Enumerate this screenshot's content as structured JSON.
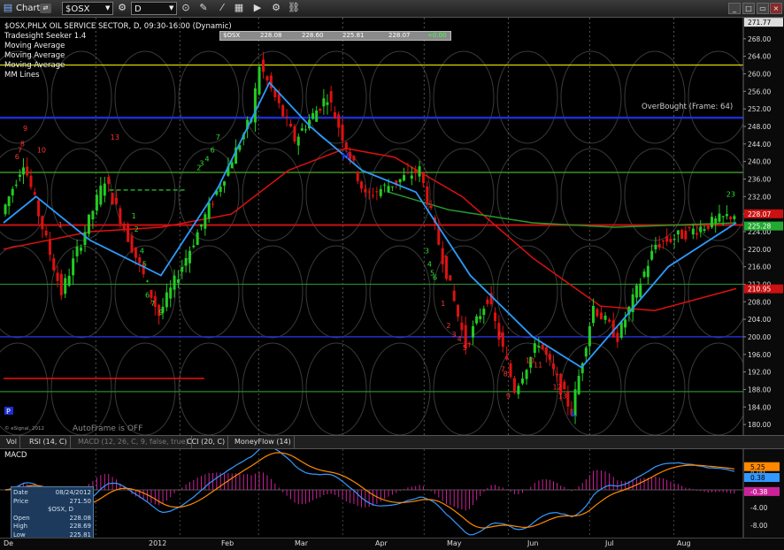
{
  "toolbar": {
    "app_label": "Chart",
    "symbol": "$OSX",
    "interval": "D",
    "buttons": [
      "zoom-icon",
      "draw-icon",
      "line-icon",
      "cursor-icon",
      "grid-icon",
      "play-icon",
      "settings-icon",
      "link-icon"
    ]
  },
  "legend": {
    "title": "$OSX,PHLX OIL SERVICE SECTOR, D, 09:30-16:00 (Dynamic)",
    "studies": [
      "Tradesight Seeker 1.4",
      "Moving Average",
      "Moving Average",
      "Moving Average",
      "MM Lines"
    ]
  },
  "quote_bar": {
    "symbol": "$OSX",
    "values": [
      "228.08",
      "228.60",
      "225.81",
      "228.07",
      "+0.00"
    ]
  },
  "overbought_label": "OverBought (Frame: 64)",
  "autoframe_label": "AutoFrame is OFF",
  "copyright": "© eSignal, 2012",
  "p_marker": "P",
  "markers": {
    "H": "H",
    "L": "L"
  },
  "seq_labels": [
    {
      "t": "9",
      "d": "2011-12-06",
      "p": 247,
      "c": "red"
    },
    {
      "t": "8",
      "d": "2011-12-05",
      "p": 243.5,
      "c": "red"
    },
    {
      "t": "7",
      "d": "2011-12-04",
      "p": 242,
      "c": "red"
    },
    {
      "t": "6",
      "d": "2011-12-03",
      "p": 240.5,
      "c": "red"
    },
    {
      "t": "10",
      "d": "2011-12-12",
      "p": 242,
      "c": "red"
    },
    {
      "t": "13",
      "d": "2012-01-08",
      "p": 245,
      "c": "red"
    },
    {
      "t": "1",
      "d": "2011-12-19",
      "p": 225,
      "c": "red"
    },
    {
      "t": "1",
      "d": "2012-01-15",
      "p": 227,
      "c": "green"
    },
    {
      "t": "2",
      "d": "2012-01-16",
      "p": 224,
      "c": "green"
    },
    {
      "t": "4",
      "d": "2012-01-18",
      "p": 219,
      "c": "green"
    },
    {
      "t": "5",
      "d": "2012-01-19",
      "p": 216,
      "c": "green"
    },
    {
      "t": "6",
      "d": "2012-01-20",
      "p": 209,
      "c": "green"
    },
    {
      "t": "7",
      "d": "2012-01-22",
      "p": 207,
      "c": "green"
    },
    {
      "t": "9",
      "d": "2012-01-25",
      "p": 205,
      "c": "green"
    },
    {
      "t": "2",
      "d": "2012-02-08",
      "p": 238,
      "c": "green"
    },
    {
      "t": "3",
      "d": "2012-02-09",
      "p": 239,
      "c": "green"
    },
    {
      "t": "4",
      "d": "2012-02-11",
      "p": 240,
      "c": "green"
    },
    {
      "t": "6",
      "d": "2012-02-13",
      "p": 242,
      "c": "green"
    },
    {
      "t": "7",
      "d": "2012-02-15",
      "p": 245,
      "c": "green"
    },
    {
      "t": "3",
      "d": "2012-05-02",
      "p": 219,
      "c": "green"
    },
    {
      "t": "4",
      "d": "2012-05-03",
      "p": 216,
      "c": "green"
    },
    {
      "t": "5",
      "d": "2012-05-04",
      "p": 214,
      "c": "green"
    },
    {
      "t": "6",
      "d": "2012-05-05",
      "p": 213,
      "c": "green"
    },
    {
      "t": "1",
      "d": "2012-05-08",
      "p": 207,
      "c": "red"
    },
    {
      "t": "2",
      "d": "2012-05-10",
      "p": 202,
      "c": "red"
    },
    {
      "t": "3",
      "d": "2012-05-12",
      "p": 200,
      "c": "red"
    },
    {
      "t": "4",
      "d": "2012-05-14",
      "p": 199,
      "c": "red"
    },
    {
      "t": "5",
      "d": "2012-05-16",
      "p": 197,
      "c": "red"
    },
    {
      "t": "6",
      "d": "2012-05-29",
      "p": 200,
      "c": "red"
    },
    {
      "t": "7",
      "d": "2012-05-30",
      "p": 192,
      "c": "red"
    },
    {
      "t": "8",
      "d": "2012-05-31",
      "p": 191,
      "c": "red"
    },
    {
      "t": "9",
      "d": "2012-06-01",
      "p": 186,
      "c": "red"
    },
    {
      "t": "10",
      "d": "2012-06-09",
      "p": 194,
      "c": "red"
    },
    {
      "t": "11",
      "d": "2012-06-12",
      "p": 193,
      "c": "red"
    },
    {
      "t": "12",
      "d": "2012-06-19",
      "p": 188,
      "c": "red"
    },
    {
      "t": "13",
      "d": "2012-06-21",
      "p": 186,
      "c": "red"
    },
    {
      "t": "23",
      "d": "2012-08-22",
      "p": 232,
      "c": "green"
    }
  ],
  "y_ticks": [
    "268.00",
    "264.00",
    "260.00",
    "256.00",
    "252.00",
    "248.00",
    "244.00",
    "240.00",
    "236.00",
    "232.00",
    "228.00",
    "224.00",
    "220.00",
    "216.00",
    "212.00",
    "208.00",
    "204.00",
    "200.00",
    "196.00",
    "192.00",
    "188.00",
    "184.00",
    "180.00"
  ],
  "price_labels": [
    {
      "t": "271.77",
      "p": 271.77,
      "bg": "#dddddd",
      "fg": "#000"
    },
    {
      "t": "228.07",
      "p": 228.07,
      "bg": "#cc1111",
      "fg": "#fff"
    },
    {
      "t": "225.28",
      "p": 225.28,
      "bg": "#22aa33",
      "fg": "#fff"
    },
    {
      "t": "210.95",
      "p": 210.95,
      "bg": "#cc1111",
      "fg": "#fff"
    }
  ],
  "tabs": [
    "Vol",
    "RSI (14, C)",
    "MACD (12, 26, C, 9, false, true)",
    "CCI (20, C)",
    "MoneyFlow (14)"
  ],
  "macd": {
    "title": "MACD",
    "y_ticks": [
      "4.00",
      "0.00",
      "-4.00",
      "-8.00"
    ],
    "labels": [
      {
        "t": "5.25",
        "v": 5.25,
        "bg": "#ff8800",
        "fg": "#000"
      },
      {
        "t": "0.38",
        "v": 2.8,
        "bg": "#3399ff",
        "fg": "#000"
      },
      {
        "t": "-0.38",
        "v": -0.38,
        "bg": "#cc2299",
        "fg": "#fff"
      }
    ]
  },
  "x_labels": [
    "De",
    "2012",
    "Feb",
    "Mar",
    "Apr",
    "May",
    "Jun",
    "Jul",
    "Aug"
  ],
  "databox": {
    "rows": [
      {
        "k": "Date",
        "v": "08/24/2012"
      },
      {
        "k": "Price",
        "v": "271.50"
      },
      {
        "k": "",
        "v": "$OSX, D"
      },
      {
        "k": "Open",
        "v": "228.08"
      },
      {
        "k": "High",
        "v": "228.69"
      },
      {
        "k": "Low",
        "v": "225.81"
      },
      {
        "k": "Close",
        "v": "228.07"
      }
    ]
  },
  "chart_data": {
    "type": "candlestick",
    "title": "$OSX,PHLX OIL SERVICE SECTOR, D, 09:30-16:00 (Dynamic)",
    "ylim": [
      178,
      272
    ],
    "swing_points": [
      {
        "d": "2011-11-28",
        "p": 228
      },
      {
        "d": "2011-12-06",
        "p": 240
      },
      {
        "d": "2011-12-20",
        "p": 210
      },
      {
        "d": "2012-01-05",
        "p": 236
      },
      {
        "d": "2012-01-25",
        "p": 205
      },
      {
        "d": "2012-02-28",
        "p": 250
      },
      {
        "d": "2012-03-02",
        "p": 262
      },
      {
        "d": "2012-03-15",
        "p": 245
      },
      {
        "d": "2012-03-27",
        "p": 255
      },
      {
        "d": "2012-04-10",
        "p": 232
      },
      {
        "d": "2012-04-30",
        "p": 238
      },
      {
        "d": "2012-05-17",
        "p": 198
      },
      {
        "d": "2012-05-25",
        "p": 209
      },
      {
        "d": "2012-06-04",
        "p": 188
      },
      {
        "d": "2012-06-13",
        "p": 199
      },
      {
        "d": "2012-06-25",
        "p": 183
      },
      {
        "d": "2012-07-03",
        "p": 207
      },
      {
        "d": "2012-07-12",
        "p": 200
      },
      {
        "d": "2012-07-26",
        "p": 221
      },
      {
        "d": "2012-08-24",
        "p": 228
      }
    ],
    "ma_blue": [
      {
        "d": "2011-11-28",
        "p": 226
      },
      {
        "d": "2011-12-10",
        "p": 232
      },
      {
        "d": "2011-12-30",
        "p": 222
      },
      {
        "d": "2012-01-25",
        "p": 214
      },
      {
        "d": "2012-02-15",
        "p": 234
      },
      {
        "d": "2012-03-05",
        "p": 258
      },
      {
        "d": "2012-03-20",
        "p": 248
      },
      {
        "d": "2012-04-08",
        "p": 238
      },
      {
        "d": "2012-04-28",
        "p": 233
      },
      {
        "d": "2012-05-18",
        "p": 214
      },
      {
        "d": "2012-06-10",
        "p": 200
      },
      {
        "d": "2012-06-28",
        "p": 193
      },
      {
        "d": "2012-07-12",
        "p": 203
      },
      {
        "d": "2012-07-30",
        "p": 216
      },
      {
        "d": "2012-08-24",
        "p": 226
      }
    ],
    "ma_green": [
      {
        "d": "2012-04-18",
        "p": 233
      },
      {
        "d": "2012-05-10",
        "p": 229
      },
      {
        "d": "2012-06-10",
        "p": 226
      },
      {
        "d": "2012-07-10",
        "p": 225
      },
      {
        "d": "2012-08-24",
        "p": 226
      }
    ],
    "ma_red": [
      {
        "d": "2011-11-28",
        "p": 220
      },
      {
        "d": "2011-12-30",
        "p": 224
      },
      {
        "d": "2012-01-25",
        "p": 225
      },
      {
        "d": "2012-02-20",
        "p": 228
      },
      {
        "d": "2012-03-12",
        "p": 238
      },
      {
        "d": "2012-04-02",
        "p": 243
      },
      {
        "d": "2012-04-20",
        "p": 241
      },
      {
        "d": "2012-05-15",
        "p": 232
      },
      {
        "d": "2012-06-10",
        "p": 218
      },
      {
        "d": "2012-07-05",
        "p": 207
      },
      {
        "d": "2012-07-25",
        "p": 206
      },
      {
        "d": "2012-08-24",
        "p": 211
      }
    ],
    "h_lines": [
      {
        "p": 262,
        "c": "#e8e800",
        "w": 1.2
      },
      {
        "p": 250,
        "c": "#1d2fcf",
        "w": 2.5
      },
      {
        "p": 237.5,
        "c": "#e8e800",
        "w": 1.2
      },
      {
        "p": 237.5,
        "c": "#2a8a2a",
        "w": 1.2
      },
      {
        "p": 225.5,
        "c": "#cc1111",
        "w": 2
      },
      {
        "p": 212,
        "c": "#2a8a2a",
        "w": 1.2
      },
      {
        "p": 200,
        "c": "#1d2fcf",
        "w": 1.5
      },
      {
        "p": 187.5,
        "c": "#2a8a2a",
        "w": 1.2
      }
    ],
    "short_lines": [
      {
        "p": 190.5,
        "c": "#ee1111",
        "d1": "2011-11-28",
        "d2": "2012-02-10"
      },
      {
        "p": 233.5,
        "c": "#22aa22",
        "d1": "2012-01-06",
        "d2": "2012-02-03",
        "dash": true
      }
    ]
  }
}
